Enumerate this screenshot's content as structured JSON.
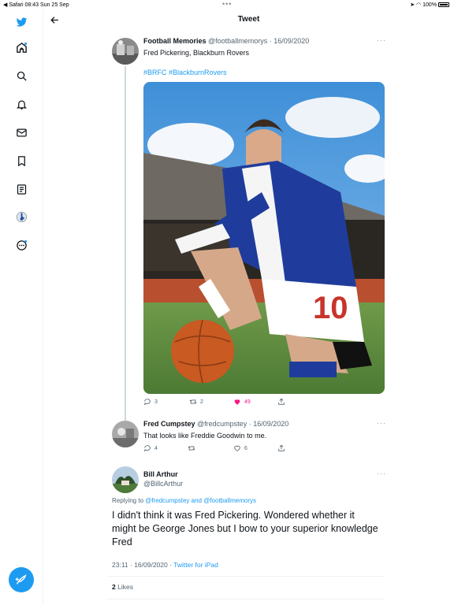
{
  "status_bar": {
    "left": "◀ Safari  08:43  Sun 25 Sep",
    "dots": "•••",
    "right": "100%"
  },
  "header": {
    "title": "Tweet"
  },
  "sidebar": {
    "items": [
      {
        "name": "twitter-logo-icon"
      },
      {
        "name": "home-icon"
      },
      {
        "name": "explore-icon"
      },
      {
        "name": "notifications-icon"
      },
      {
        "name": "messages-icon"
      },
      {
        "name": "bookmarks-icon"
      },
      {
        "name": "lists-icon"
      },
      {
        "name": "profile-icon"
      },
      {
        "name": "more-icon"
      }
    ],
    "compose_icon": "compose-tweet-icon"
  },
  "tweet1": {
    "display_name": "Football Memories",
    "handle_date": "@footballmemorys · 16/09/2020",
    "text": "Fred Pickering, Blackburn Rovers",
    "hashtags": "#BRFC #BlackburnRovers",
    "more": "···",
    "replies": "3",
    "retweets": "2",
    "likes": "49"
  },
  "tweet2": {
    "display_name": "Fred Cumpstey",
    "handle_date": "@fredcumpstey · 16/09/2020",
    "text": "That looks like Freddie Goodwin to me.",
    "more": "···",
    "replies": "4",
    "likes": "6"
  },
  "main_tweet": {
    "display_name": "Bill Arthur",
    "handle": "@BillcArthur",
    "more": "···",
    "replying_prefix": "Replying to ",
    "replying_user1": "@fredcumpstey",
    "replying_and": " and ",
    "replying_user2": "@footballmemorys",
    "text": "I didn't think it was Fred Pickering. Wondered whether it might be George Jones but I bow to your superior knowledge Fred",
    "time_date": "23:11 · 16/09/2020 · ",
    "source": "Twitter for iPad",
    "likes_count": "2",
    "likes_label": " Likes"
  },
  "colors": {
    "accent": "#1d9bf0",
    "like": "#f91880"
  }
}
